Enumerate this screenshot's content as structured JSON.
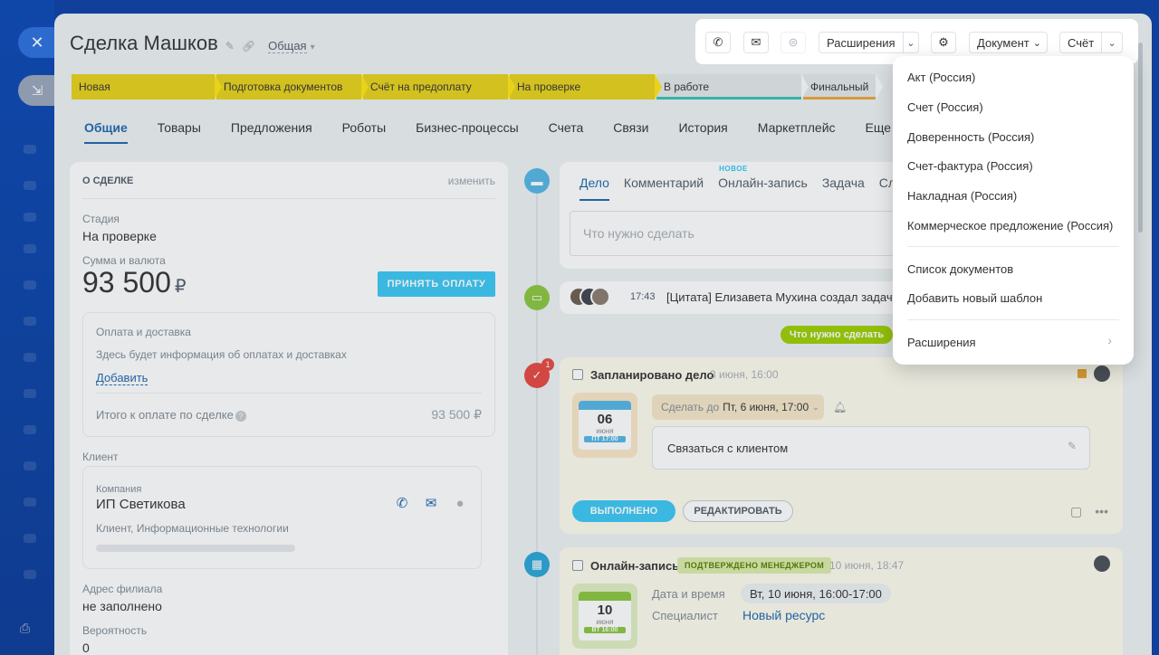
{
  "rail": {
    "close_icon": "close-icon",
    "pin_icon": "pin-icon"
  },
  "deal": {
    "title": "Сделка Машков",
    "category": "Общая"
  },
  "stages": [
    {
      "label": "Новая",
      "state": "done"
    },
    {
      "label": "Подготовка документов",
      "state": "done"
    },
    {
      "label": "Счёт на предоплату",
      "state": "done"
    },
    {
      "label": "На проверке",
      "state": "done"
    },
    {
      "label": "В работе",
      "state": "todo"
    },
    {
      "label": "Финальный",
      "state": "todo"
    }
  ],
  "tabs": [
    "Общие",
    "Товары",
    "Предложения",
    "Роботы",
    "Бизнес-процессы",
    "Счета",
    "Связи",
    "История",
    "Маркетплейс",
    "Еще"
  ],
  "about": {
    "header": "О СДЕЛКЕ",
    "edit": "изменить",
    "stage_label": "Стадия",
    "stage_value": "На проверке",
    "amount_label": "Сумма и валюта",
    "amount": "93 500",
    "currency": "₽",
    "pay_button": "ПРИНЯТЬ ОПЛАТУ",
    "payment": {
      "label": "Оплата и доставка",
      "text": "Здесь будет информация об оплатах и доставках",
      "add": "Добавить",
      "total_label": "Итого к оплате по сделке",
      "total_value": "93 500 ₽"
    },
    "client_label": "Клиент",
    "client": {
      "company_label": "Компания",
      "name": "ИП Светикова",
      "info": "Клиент, Информационные технологии"
    },
    "address_label": "Адрес филиала",
    "address_value": "не заполнено",
    "probability_label": "Вероятность",
    "probability_value": "0"
  },
  "editor": {
    "tabs": [
      "Дело",
      "Комментарий",
      "Онлайн-запись",
      "Задача",
      "Сл"
    ],
    "new_badge": "НОВОЕ",
    "placeholder": "Что нужно сделать"
  },
  "history": {
    "time": "17:43",
    "text": "[Цитата] Елизавета Мухина создал задачу"
  },
  "todo_chip": "Что нужно сделать",
  "activity1": {
    "badge": "1",
    "title": "Запланировано дело",
    "date": "3 июня, 16:00",
    "cal_day": "06",
    "cal_month": "июня",
    "cal_time": "ПТ 17:00",
    "deadline_label": "Сделать до",
    "deadline_value": "Пт, 6 июня, 17:00",
    "task": "Связаться с клиентом",
    "done_button": "ВЫПОЛНЕНО",
    "edit_button": "РЕДАКТИРОВАТЬ"
  },
  "activity2": {
    "title": "Онлайн-запись",
    "status": "ПОДТВЕРЖДЕНО МЕНЕДЖЕРОМ",
    "date": "10 июня, 18:47",
    "cal_day": "10",
    "cal_month": "июня",
    "cal_time": "ВТ 16:00",
    "datetime_label": "Дата и время",
    "datetime_value": "Вт, 10 июня, 16:00-17:00",
    "specialist_label": "Специалист",
    "specialist_value": "Новый ресурс"
  },
  "toolbar": {
    "extensions": "Расширения",
    "document": "Документ",
    "invoice": "Счёт"
  },
  "menu": {
    "items": [
      "Акт (Россия)",
      "Счет (Россия)",
      "Доверенность (Россия)",
      "Счет-фактура (Россия)",
      "Накладная (Россия)",
      "Коммерческое предложение (Россия)"
    ],
    "list": "Список документов",
    "add_template": "Добавить новый шаблон",
    "extensions": "Расширения"
  },
  "colors": {
    "accent": "#2067b0",
    "stage_done": "#e9d21a",
    "primary_button": "#3bc8f5",
    "todo_chip": "#9dcf00"
  }
}
